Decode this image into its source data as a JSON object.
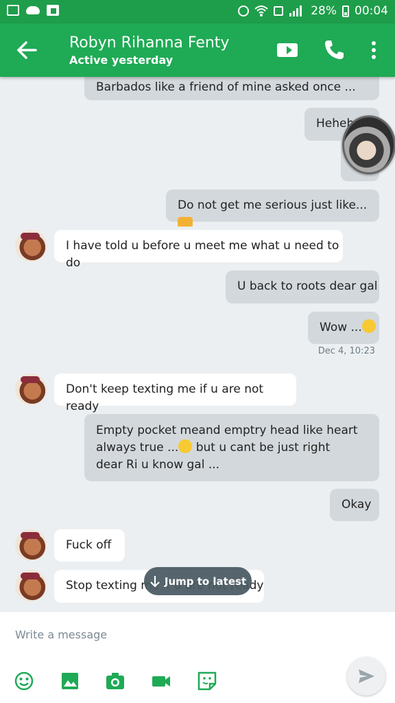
{
  "status_bar": {
    "battery": "28%",
    "time": "00:04"
  },
  "header": {
    "contact_name": "Robyn Rihanna Fenty",
    "status": "Active yesterday"
  },
  "messages": [
    {
      "dir": "out",
      "text": "Barbados like a friend of mine asked once ..."
    },
    {
      "dir": "out",
      "text": "Heheh"
    },
    {
      "dir": "out",
      "text": "Do not get me serious just like... "
    },
    {
      "dir": "in",
      "text": "I have told u before u meet me what u need to do"
    },
    {
      "dir": "out",
      "text": "U back to roots dear gal"
    },
    {
      "dir": "out",
      "text": "Wow ..."
    },
    {
      "dir": "in",
      "text": "Don't keep texting me if u are not ready"
    },
    {
      "dir": "out",
      "lines": [
        "Empty pocket meand emptry head like heart",
        "always true ...",
        " but u cant be just right",
        "dear Ri u know gal ..."
      ]
    },
    {
      "dir": "out",
      "text": "Okay"
    },
    {
      "dir": "in",
      "text": "Fuck off"
    },
    {
      "dir": "in",
      "text": "Stop texting me if u are not ready"
    }
  ],
  "timestamp": "Dec 4, 10:23",
  "jump_button": "Jump to latest",
  "composer": {
    "placeholder": "Write a message"
  },
  "icons": [
    "back-arrow-icon",
    "video-call-icon",
    "phone-icon",
    "more-vert-icon",
    "emoji-icon",
    "gallery-icon",
    "camera-icon",
    "video-icon",
    "sticker-icon",
    "send-icon"
  ],
  "colors": {
    "app_bar": "#1faa55",
    "status_bar": "#1e9e4a",
    "outgoing_bubble": "#d3d8dc",
    "incoming_bubble": "#ffffff",
    "background": "#eceff1"
  }
}
